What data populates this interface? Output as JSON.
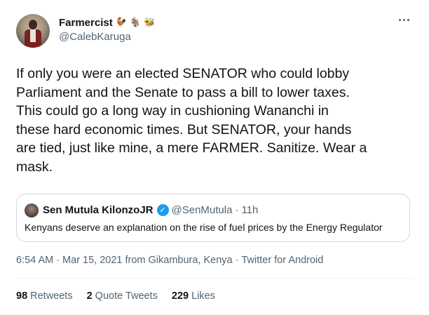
{
  "author": {
    "display_name": "Farmercist",
    "emojis": [
      "🐓",
      "🐐",
      "🐝"
    ],
    "handle": "@CalebKaruga"
  },
  "tweet": {
    "text": "If only you were an elected SENATOR who could lobby\nParliament and the Senate to pass a bill to lower taxes.\nThis could go a long way in cushioning Wananchi in\nthese hard economic times. But SENATOR, your hands\nare tied, just like mine, a mere FARMER. Sanitize. Wear a\nmask."
  },
  "quoted_tweet": {
    "display_name": "Sen Mutula KilonzoJR",
    "handle": "@SenMutula",
    "separator": "·",
    "time": "11h",
    "text": "Kenyans deserve an explanation on the rise of fuel prices by the Energy Regulator"
  },
  "meta": {
    "time": "6:54 AM",
    "sep1": "·",
    "date": "Mar 15, 2021",
    "location": "from Gikambura, Kenya",
    "sep2": "·",
    "source": "Twitter for Android"
  },
  "stats": {
    "retweets_count": "98",
    "retweets_label": "Retweets",
    "quotes_count": "2",
    "quotes_label": "Quote Tweets",
    "likes_count": "229",
    "likes_label": "Likes"
  },
  "icons": {
    "more": "more-horizontal-icon",
    "verified": "verified-badge-icon"
  },
  "colors": {
    "text_primary": "#0f1419",
    "text_secondary": "#536471",
    "border": "#cfd9de",
    "verified": "#1d9bf0"
  }
}
